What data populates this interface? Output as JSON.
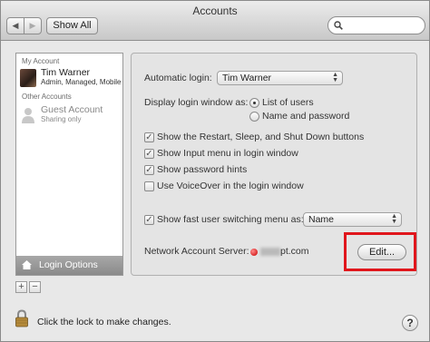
{
  "window": {
    "title": "Accounts"
  },
  "toolbar": {
    "back_label": "◀",
    "forward_label": "▶",
    "show_all_label": "Show All",
    "search_placeholder": ""
  },
  "sidebar": {
    "my_account_header": "My Account",
    "current_user": {
      "name": "Tim Warner",
      "detail": "Admin, Managed, Mobile"
    },
    "other_accounts_header": "Other Accounts",
    "guest": {
      "name": "Guest Account",
      "detail": "Sharing only"
    },
    "login_options_label": "Login Options",
    "add_label": "+",
    "remove_label": "−"
  },
  "login_options": {
    "automatic_login_label": "Automatic login:",
    "automatic_login_value": "Tim Warner",
    "display_window_label": "Display login window as:",
    "radio_list_label": "List of users",
    "radio_name_label": "Name and password",
    "radio_selected": "List of users",
    "checkboxes": [
      {
        "label": "Show the Restart, Sleep, and Shut Down buttons",
        "checked": true
      },
      {
        "label": "Show Input menu in login window",
        "checked": true
      },
      {
        "label": "Show password hints",
        "checked": true
      },
      {
        "label": "Use VoiceOver in the login window",
        "checked": false
      }
    ],
    "fast_switch_label": "Show fast user switching menu as:",
    "fast_switch_checked": true,
    "fast_switch_value": "Name",
    "network_server_label": "Network Account Server:",
    "network_server_value": "pt.com",
    "edit_button_label": "Edit..."
  },
  "footer": {
    "lock_text": "Click the lock to make changes.",
    "help_label": "?"
  },
  "colors": {
    "highlight": "#e0161c",
    "status_dot": "#c90000"
  }
}
